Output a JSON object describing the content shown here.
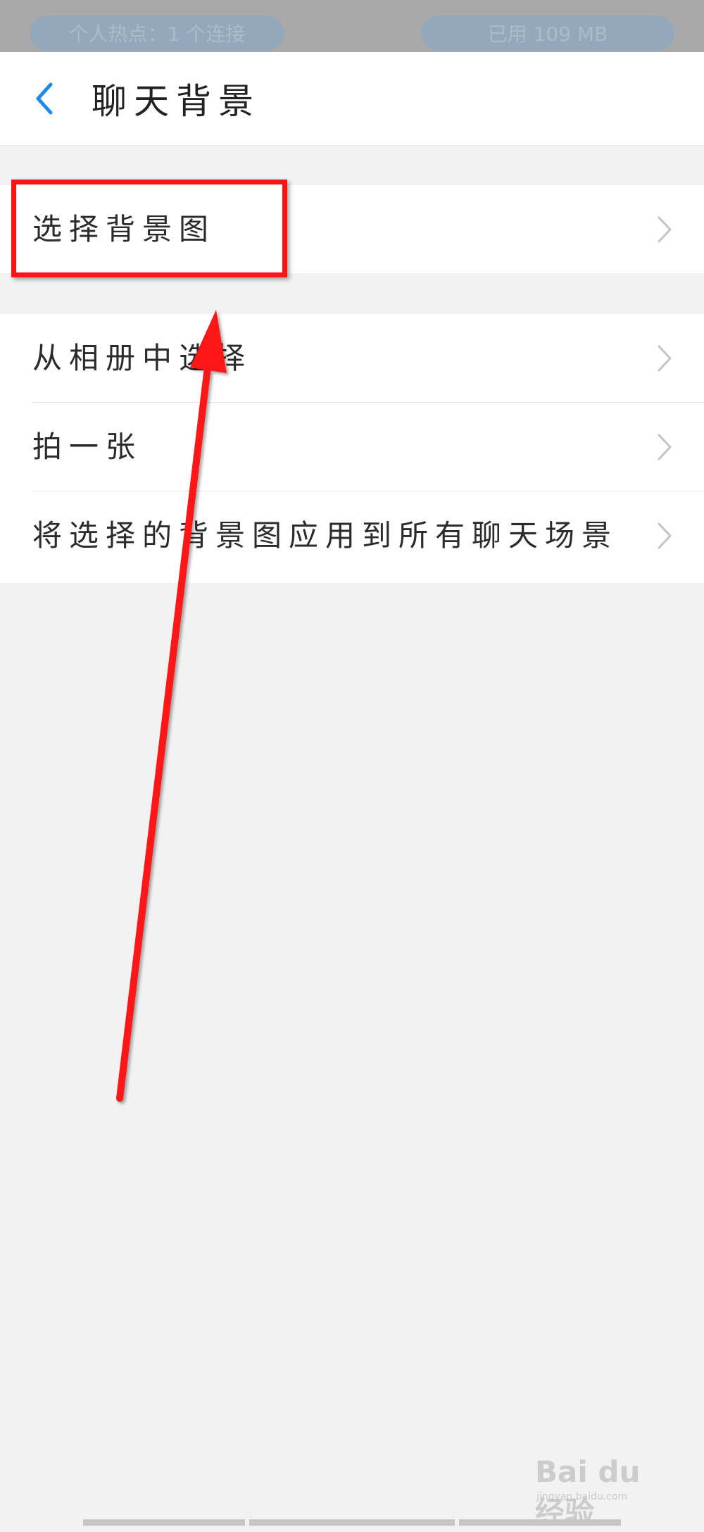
{
  "status_bar": {
    "hotspot_text": "个人热点：1 个连接",
    "data_used_text": "已用 109 MB"
  },
  "header": {
    "back_icon": "chevron-left-icon",
    "title": "聊天背景"
  },
  "menu": {
    "select_background": "选择背景图",
    "items": [
      {
        "label": "从相册中选择"
      },
      {
        "label": "拍一张"
      },
      {
        "label": "将选择的背景图应用到所有聊天场景"
      }
    ]
  },
  "annotation": {
    "highlight_color": "#ff1414",
    "arrow_color": "#ff1414"
  },
  "watermark": {
    "logo_text": "Bai du 经验",
    "url": "jingyan.baidu.com"
  },
  "colors": {
    "accent": "#1e88e5",
    "background": "#f2f2f2",
    "card": "#ffffff"
  }
}
